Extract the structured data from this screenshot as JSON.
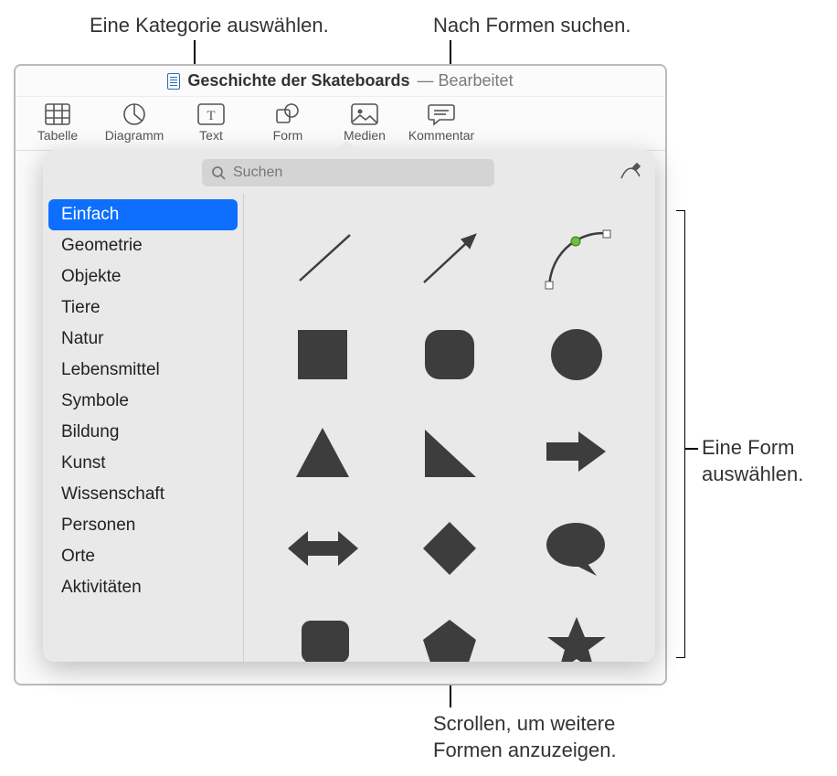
{
  "callouts": {
    "select_category": "Eine Kategorie auswählen.",
    "search_shapes": "Nach Formen suchen.",
    "select_shape": "Eine Form\nauswählen.",
    "scroll_more": "Scrollen, um weitere\nFormen anzuzeigen."
  },
  "titlebar": {
    "document_title": "Geschichte der Skateboards",
    "edited_suffix": "— Bearbeitet"
  },
  "toolbar": {
    "items": [
      {
        "label": "Tabelle",
        "icon": "table-icon"
      },
      {
        "label": "Diagramm",
        "icon": "chart-icon"
      },
      {
        "label": "Text",
        "icon": "text-icon"
      },
      {
        "label": "Form",
        "icon": "shape-icon"
      },
      {
        "label": "Medien",
        "icon": "media-icon"
      },
      {
        "label": "Kommentar",
        "icon": "comment-icon"
      }
    ]
  },
  "popover": {
    "search_placeholder": "Suchen",
    "categories": [
      "Einfach",
      "Geometrie",
      "Objekte",
      "Tiere",
      "Natur",
      "Lebensmittel",
      "Symbole",
      "Bildung",
      "Kunst",
      "Wissenschaft",
      "Personen",
      "Orte",
      "Aktivitäten"
    ],
    "selected_category_index": 0,
    "shapes": [
      "line",
      "arrow-line",
      "bezier-curve",
      "square",
      "rounded-square",
      "circle",
      "triangle",
      "right-triangle",
      "arrow-right",
      "double-arrow",
      "diamond",
      "speech-bubble",
      "callout-square",
      "pentagon",
      "star"
    ]
  },
  "colors": {
    "selection": "#0e6fff",
    "shape_fill": "#3d3d3d"
  }
}
